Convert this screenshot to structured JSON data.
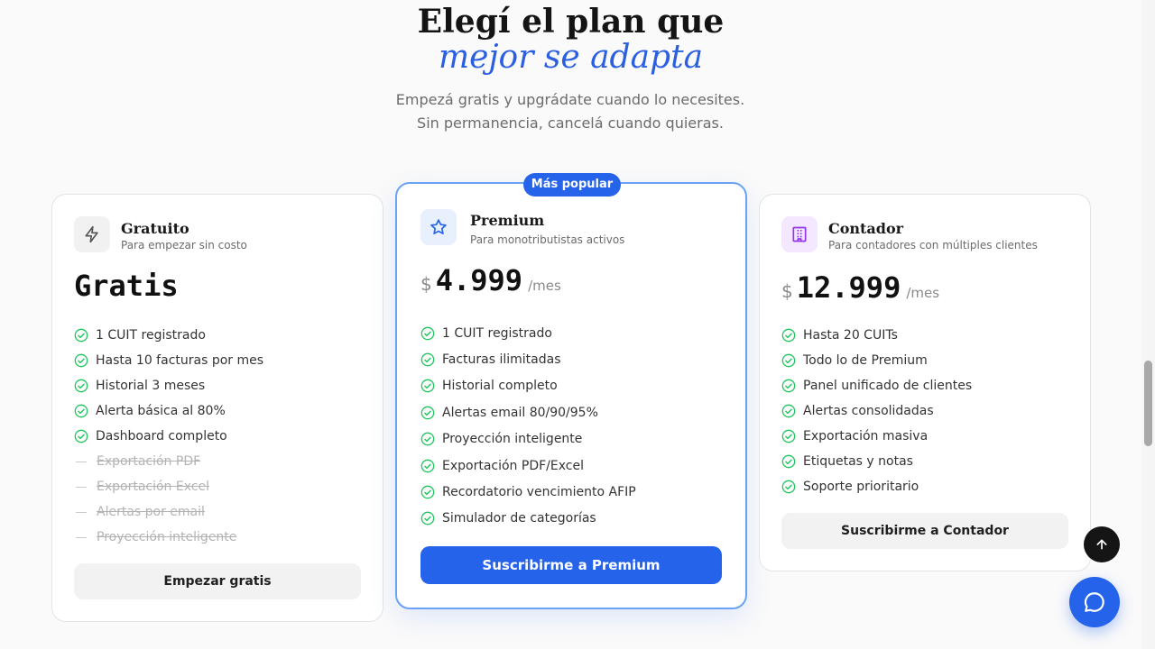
{
  "hero": {
    "title_line1": "Elegí el plan que",
    "title_line2": "mejor se adapta",
    "subtitle": "Empezá gratis y upgrádate cuando lo necesites. Sin permanencia, cancelá cuando quieras."
  },
  "plans": [
    {
      "name": "Gratuito",
      "description": "Para empezar sin costo",
      "icon": "lightning-icon",
      "price_text": "Gratis",
      "features": [
        {
          "label": "1 CUIT registrado",
          "included": true
        },
        {
          "label": "Hasta 10 facturas por mes",
          "included": true
        },
        {
          "label": "Historial 3 meses",
          "included": true
        },
        {
          "label": "Alerta básica al 80%",
          "included": true
        },
        {
          "label": "Dashboard completo",
          "included": true
        },
        {
          "label": "Exportación PDF",
          "included": false
        },
        {
          "label": "Exportación Excel",
          "included": false
        },
        {
          "label": "Alertas por email",
          "included": false
        },
        {
          "label": "Proyección inteligente",
          "included": false
        }
      ],
      "cta": "Empezar gratis"
    },
    {
      "name": "Premium",
      "description": "Para monotributistas activos",
      "icon": "star-icon",
      "badge": "Más popular",
      "currency": "$",
      "price": "4.999",
      "period": "/mes",
      "features": [
        {
          "label": "1 CUIT registrado",
          "included": true
        },
        {
          "label": "Facturas ilimitadas",
          "included": true
        },
        {
          "label": "Historial completo",
          "included": true
        },
        {
          "label": "Alertas email 80/90/95%",
          "included": true
        },
        {
          "label": "Proyección inteligente",
          "included": true
        },
        {
          "label": "Exportación PDF/Excel",
          "included": true
        },
        {
          "label": "Recordatorio vencimiento AFIP",
          "included": true
        },
        {
          "label": "Simulador de categorías",
          "included": true
        }
      ],
      "cta": "Suscribirme a Premium"
    },
    {
      "name": "Contador",
      "description": "Para contadores con múltiples clientes",
      "icon": "building-icon",
      "currency": "$",
      "price": "12.999",
      "period": "/mes",
      "features": [
        {
          "label": "Hasta 20 CUITs",
          "included": true
        },
        {
          "label": "Todo lo de Premium",
          "included": true
        },
        {
          "label": "Panel unificado de clientes",
          "included": true
        },
        {
          "label": "Alertas consolidadas",
          "included": true
        },
        {
          "label": "Exportación masiva",
          "included": true
        },
        {
          "label": "Etiquetas y notas",
          "included": true
        },
        {
          "label": "Soporte prioritario",
          "included": true
        }
      ],
      "cta": "Suscribirme a Contador"
    }
  ],
  "colors": {
    "accent": "#2563eb",
    "check": "#22c55e",
    "highlight_border": "#6aa3f5"
  },
  "floating": {
    "scroll_top_icon": "arrow-up-icon",
    "chat_icon": "chat-bubble-icon"
  }
}
